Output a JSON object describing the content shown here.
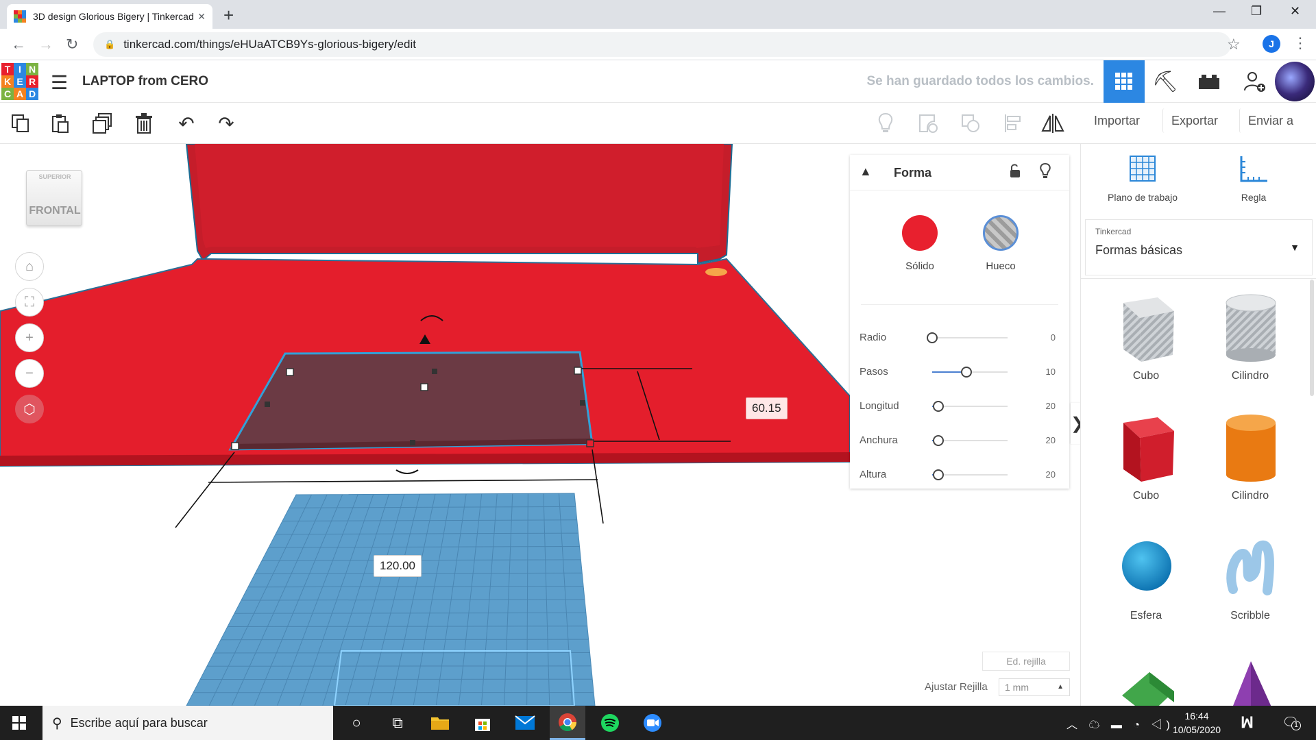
{
  "browser": {
    "tab_title": "3D design Glorious Bigery | Tinkercad",
    "url": "tinkercad.com/things/eHUaATCB9Ys-glorious-bigery/edit",
    "profile_initial": "J",
    "new_tab": "+",
    "tab_close": "✕"
  },
  "header": {
    "logo_letters": [
      "T",
      "I",
      "N",
      "K",
      "E",
      "R",
      "C",
      "A",
      "D"
    ],
    "project_name": "LAPTOP from CERO",
    "save_status": "Se han guardado todos los cambios."
  },
  "toolbar": {
    "import_label": "Importar",
    "export_label": "Exportar",
    "send_label": "Enviar a"
  },
  "viewcube": {
    "top": "SUPERIOR",
    "front": "FRONTAL"
  },
  "dimensions": {
    "width_value": "120.00",
    "depth_value": "60.15"
  },
  "inspector": {
    "title": "Forma",
    "solid_label": "Sólido",
    "hole_label": "Hueco",
    "params": [
      {
        "label": "Radio",
        "value": "0",
        "level": 0.0
      },
      {
        "label": "Pasos",
        "value": "10",
        "level": 0.45
      },
      {
        "label": "Longitud",
        "value": "20",
        "level": 0.08
      },
      {
        "label": "Anchura",
        "value": "20",
        "level": 0.08
      },
      {
        "label": "Altura",
        "value": "20",
        "level": 0.08
      }
    ]
  },
  "grid": {
    "edit_label": "Ed. rejilla",
    "snap_label": "Ajustar Rejilla",
    "snap_value": "1 mm"
  },
  "panel": {
    "workplane_label": "Plano de trabajo",
    "ruler_label": "Regla",
    "library_source": "Tinkercad",
    "library_name": "Formas básicas",
    "shapes": [
      {
        "label": "Cubo"
      },
      {
        "label": "Cilindro"
      },
      {
        "label": "Cubo"
      },
      {
        "label": "Cilindro"
      },
      {
        "label": "Esfera"
      },
      {
        "label": "Scribble"
      }
    ]
  },
  "taskbar": {
    "search_placeholder": "Escribe aquí para buscar",
    "time": "16:44",
    "date": "10/05/2020",
    "notification_count": "1"
  },
  "colors": {
    "tinkercad_red": "#e8202e",
    "workplane_blue": "#5d9fcc",
    "accent_blue": "#2c87e2"
  }
}
